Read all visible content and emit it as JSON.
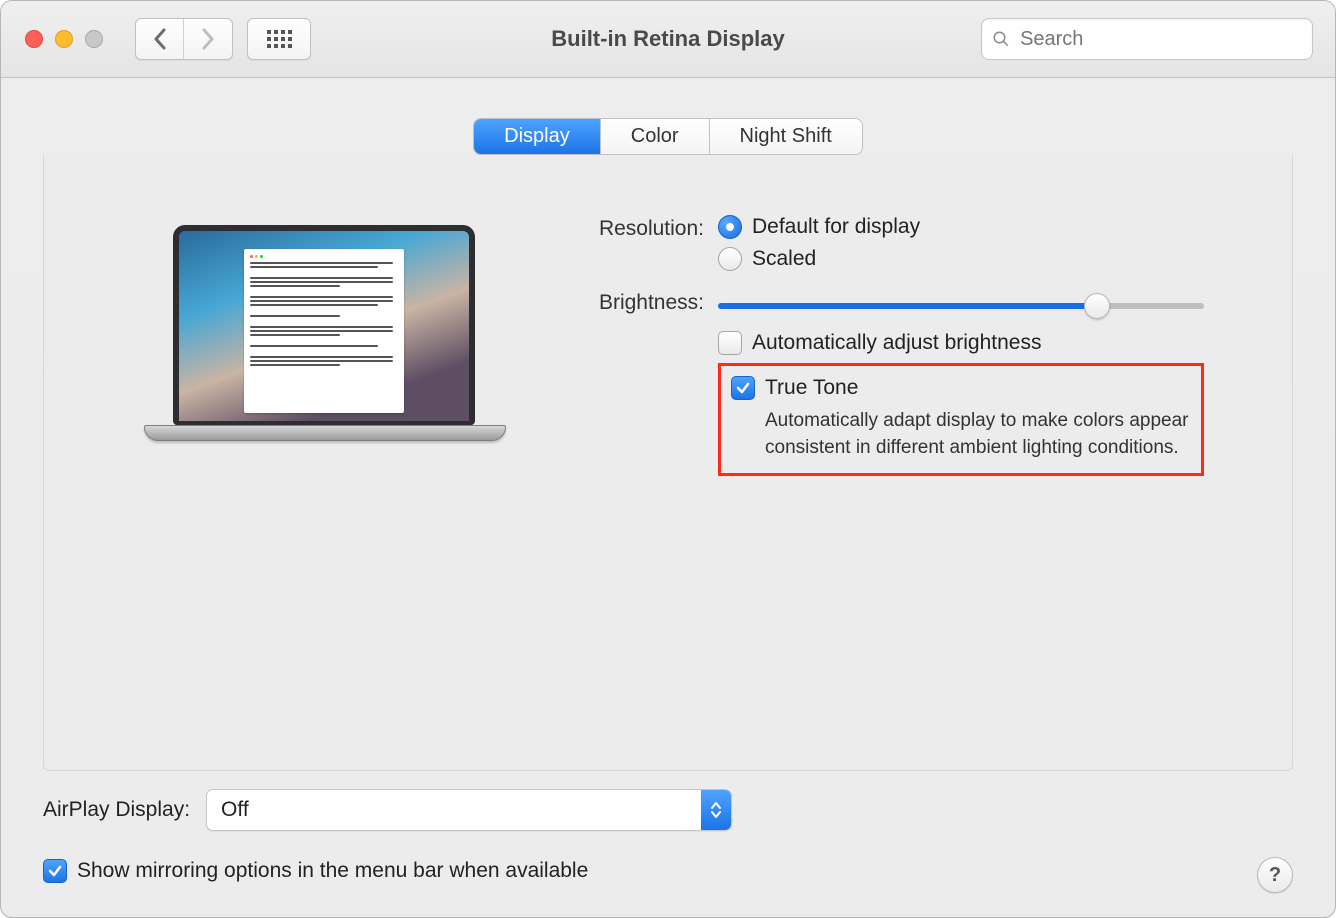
{
  "window": {
    "title": "Built-in Retina Display"
  },
  "search": {
    "placeholder": "Search"
  },
  "tabs": {
    "display": "Display",
    "color": "Color",
    "night_shift": "Night Shift"
  },
  "resolution": {
    "label": "Resolution:",
    "default": "Default for display",
    "scaled": "Scaled"
  },
  "brightness": {
    "label": "Brightness:",
    "value_pct": 78,
    "auto_label": "Automatically adjust brightness"
  },
  "true_tone": {
    "label": "True Tone",
    "desc": "Automatically adapt display to make colors appear consistent in different ambient lighting conditions."
  },
  "airplay": {
    "label": "AirPlay Display:",
    "value": "Off"
  },
  "mirroring": {
    "label": "Show mirroring options in the menu bar when available"
  },
  "help": {
    "glyph": "?"
  }
}
